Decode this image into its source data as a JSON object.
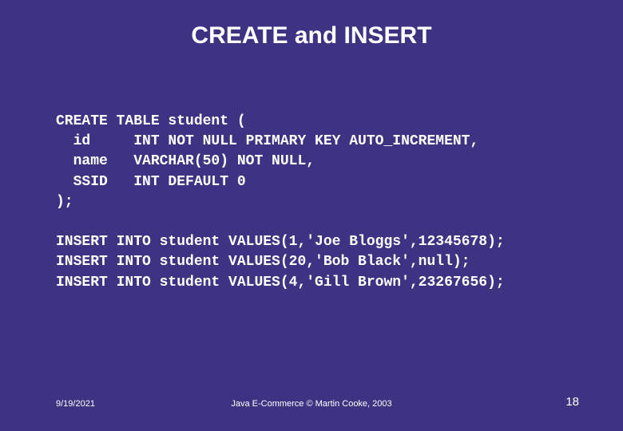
{
  "title": "CREATE and INSERT",
  "code": "CREATE TABLE student (\n  id     INT NOT NULL PRIMARY KEY AUTO_INCREMENT,\n  name   VARCHAR(50) NOT NULL,\n  SSID   INT DEFAULT 0\n);\n\nINSERT INTO student VALUES(1,'Joe Bloggs',12345678);\nINSERT INTO student VALUES(20,'Bob Black',null);\nINSERT INTO student VALUES(4,'Gill Brown',23267656);",
  "footer": {
    "date": "9/19/2021",
    "center": "Java E-Commerce © Martin Cooke, 2003",
    "page": "18"
  }
}
